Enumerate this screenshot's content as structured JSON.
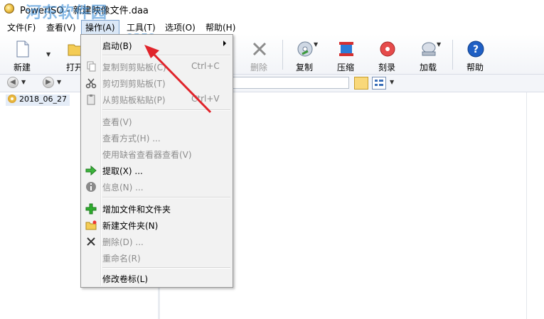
{
  "window": {
    "title": "PowerISO - 新建映像文件.daa"
  },
  "watermark": {
    "text": "河东软件园",
    "url": "www.pc0359.cn"
  },
  "menubar": {
    "items": [
      "文件(F)",
      "查看(V)",
      "操作(A)",
      "工具(T)",
      "选项(O)",
      "帮助(H)"
    ]
  },
  "toolbar": {
    "new": "新建",
    "open": "打开",
    "delete": "删除",
    "copy": "复制",
    "compress": "压缩",
    "burn": "刻录",
    "mount": "加载",
    "help": "帮助"
  },
  "tree": {
    "root": "2018_06_27"
  },
  "context_menu": {
    "items": [
      {
        "label": "启动(B)",
        "shortcut": "",
        "enabled": true,
        "submenu": true,
        "icon": ""
      },
      {
        "label": "复制到剪贴板(C)",
        "shortcut": "Ctrl+C",
        "enabled": false,
        "icon": "copy-icon"
      },
      {
        "label": "剪切到剪贴板(T)",
        "shortcut": "",
        "enabled": false,
        "icon": "scissors-icon"
      },
      {
        "label": "从剪贴板粘贴(P)",
        "shortcut": "Ctrl+V",
        "enabled": false,
        "icon": "paste-icon"
      },
      {
        "label": "查看(V)",
        "shortcut": "",
        "enabled": false,
        "icon": ""
      },
      {
        "label": "查看方式(H) ...",
        "shortcut": "",
        "enabled": false,
        "icon": ""
      },
      {
        "label": "使用缺省查看器查看(V)",
        "shortcut": "",
        "enabled": false,
        "icon": ""
      },
      {
        "label": "提取(X) ...",
        "shortcut": "",
        "enabled": true,
        "icon": "extract-arrow-icon"
      },
      {
        "label": "信息(N) ...",
        "shortcut": "",
        "enabled": false,
        "icon": "info-icon"
      },
      {
        "label": "增加文件和文件夹",
        "shortcut": "",
        "enabled": true,
        "icon": "add-plus-icon"
      },
      {
        "label": "新建文件夹(N)",
        "shortcut": "",
        "enabled": true,
        "icon": "new-folder-icon"
      },
      {
        "label": "删除(D) ...",
        "shortcut": "",
        "enabled": false,
        "icon": "delete-x-icon"
      },
      {
        "label": "重命名(R)",
        "shortcut": "",
        "enabled": false,
        "icon": ""
      },
      {
        "label": "修改卷标(L)",
        "shortcut": "",
        "enabled": true,
        "icon": ""
      }
    ]
  },
  "colors": {
    "annotation_arrow": "#e0242b",
    "menu_highlight": "#dbe8f7",
    "watermark": "#2882d2"
  }
}
